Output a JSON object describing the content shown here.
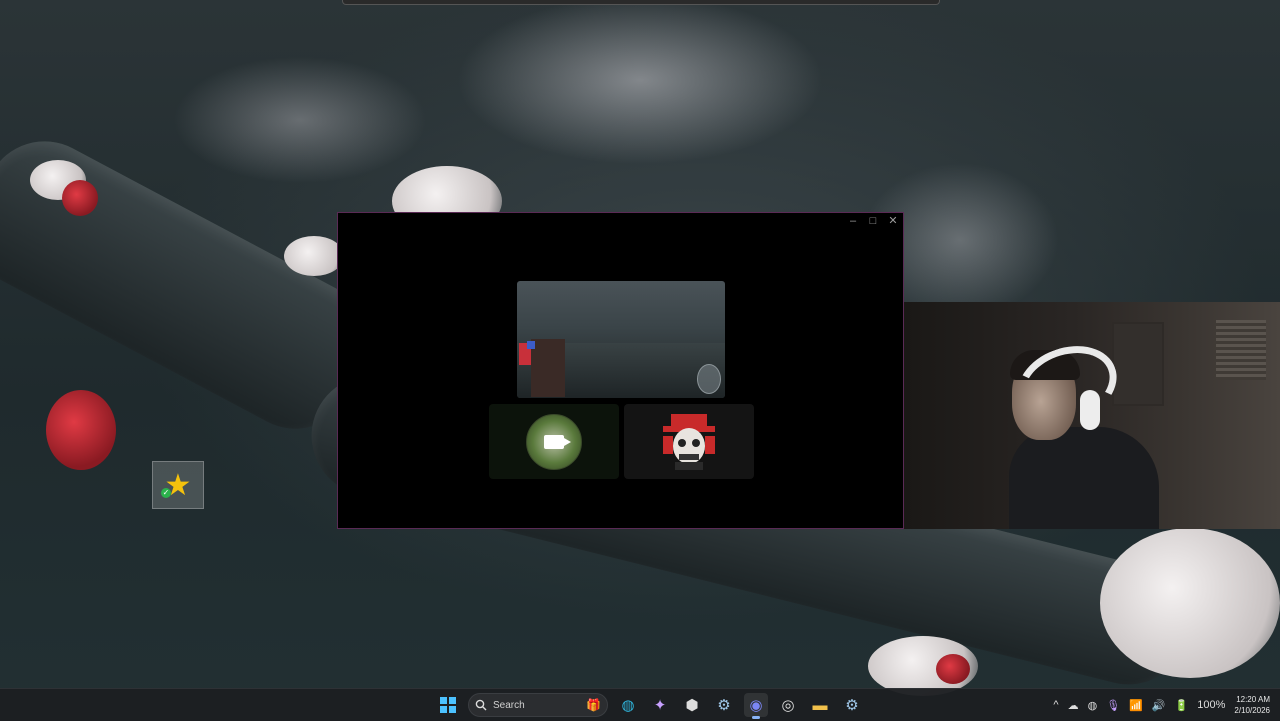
{
  "desktop": {
    "icon_name": "star-icon",
    "icon_glyph": "★"
  },
  "window": {
    "controls": {
      "minimize": "–",
      "maximize": "□",
      "close": "✕"
    },
    "participants": [
      {
        "icon": "camera-icon"
      },
      {
        "icon": "samurai-mask-icon",
        "glyph": "👹"
      }
    ]
  },
  "taskbar": {
    "start_icon": "windows-start-icon",
    "search_placeholder": "Search",
    "search_icon": "search-icon",
    "pinned": [
      {
        "name": "folder-gift-icon",
        "glyph": "🎁"
      },
      {
        "name": "edge-icon",
        "glyph": "◍"
      },
      {
        "name": "copilot-icon",
        "glyph": "✦"
      },
      {
        "name": "cube-app-icon",
        "glyph": "⬢"
      },
      {
        "name": "steam-icon",
        "glyph": "⚙"
      },
      {
        "name": "discord-icon",
        "glyph": "◉",
        "active": true
      },
      {
        "name": "obs-icon",
        "glyph": "◎"
      },
      {
        "name": "file-explorer-icon",
        "glyph": "▬"
      },
      {
        "name": "steam-icon-2",
        "glyph": "⚙"
      }
    ],
    "tray": {
      "chevron": "^",
      "battery_percent": "100%",
      "time": "12:20 AM",
      "date": "2/10/2026"
    }
  },
  "colors": {
    "window_border": "#5a2a55",
    "taskbar_bg": "#1c1e21",
    "active_indicator": "#8ab4f8"
  }
}
